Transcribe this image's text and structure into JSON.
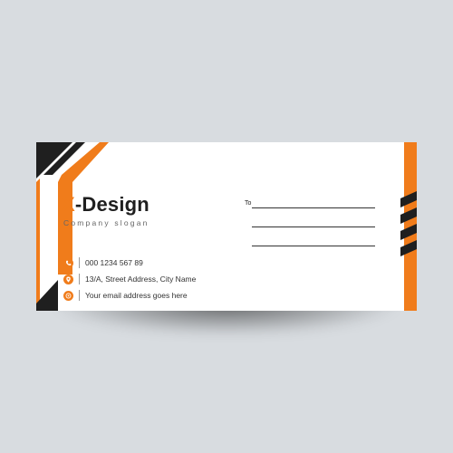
{
  "brand": {
    "logo_x": "X",
    "logo_rest": "-Design",
    "slogan": "Company slogan"
  },
  "contacts": [
    {
      "icon": "phone-icon",
      "text": "000 1234 567 89"
    },
    {
      "icon": "location-pin-icon",
      "text": "13/A, Street Address, City Name"
    },
    {
      "icon": "email-icon",
      "text": "Your email address goes here"
    }
  ],
  "recipient": {
    "label": "To"
  },
  "colors": {
    "accent": "#f07c1b",
    "dark": "#1f1f1f",
    "background": "#d8dce0"
  }
}
